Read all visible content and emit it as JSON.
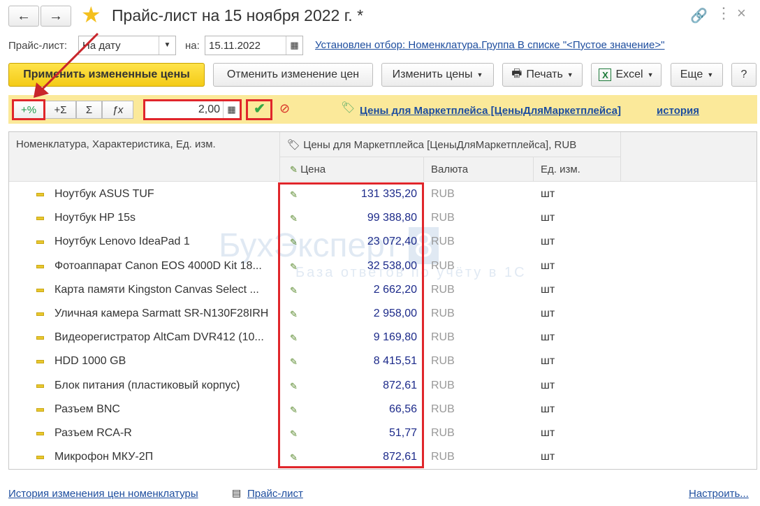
{
  "window": {
    "title": "Прайс-лист на 15 ноября 2022 г. *"
  },
  "filter": {
    "pricelist_label": "Прайс-лист:",
    "pricelist_value": "На дату",
    "date_label": "на:",
    "date_value": "15.11.2022",
    "filter_link": "Установлен отбор: Номенклатура.Группа В списке \"<Пустое значение>\""
  },
  "toolbar": {
    "apply": "Применить измененные цены",
    "cancel": "Отменить изменение цен",
    "change": "Изменить цены",
    "print": "Печать",
    "excel": "Excel",
    "more": "Еще",
    "help": "?"
  },
  "edit_panel": {
    "plus_percent": "+%",
    "plus_sum": "+Σ",
    "sum": "Σ",
    "fx": "ƒx",
    "value": "2,00",
    "price_type_link": "Цены для Маркетплейса [ЦеныДляМаркетплейса]",
    "history_link": "история"
  },
  "table": {
    "col_name": "Номенклатура, Характеристика, Ед. изм.",
    "col_group": "Цены для Маркетплейса [ЦеныДляМаркетплейса], RUB",
    "col_price": "Цена",
    "col_currency": "Валюта",
    "col_unit": "Ед. изм.",
    "rows": [
      {
        "name": "Ноутбук ASUS TUF",
        "price": "131 335,20",
        "currency": "RUB",
        "unit": "шт"
      },
      {
        "name": "Ноутбук HP 15s",
        "price": "99 388,80",
        "currency": "RUB",
        "unit": "шт"
      },
      {
        "name": "Ноутбук Lenovo IdeaPad 1",
        "price": "23 072,40",
        "currency": "RUB",
        "unit": "шт"
      },
      {
        "name": "Фотоаппарат Canon EOS 4000D Kit 18...",
        "price": "32 538,00",
        "currency": "RUB",
        "unit": "шт"
      },
      {
        "name": "Карта памяти Kingston Canvas Select ...",
        "price": "2 662,20",
        "currency": "RUB",
        "unit": "шт"
      },
      {
        "name": "Уличная камера Sarmatt SR-N130F28IRH",
        "price": "2 958,00",
        "currency": "RUB",
        "unit": "шт"
      },
      {
        "name": "Видеорегистратор AltCam DVR412 (10...",
        "price": "9 169,80",
        "currency": "RUB",
        "unit": "шт"
      },
      {
        "name": "HDD 1000 GB",
        "price": "8 415,51",
        "currency": "RUB",
        "unit": "шт"
      },
      {
        "name": "Блок питания (пластиковый корпус)",
        "price": "872,61",
        "currency": "RUB",
        "unit": "шт"
      },
      {
        "name": "Разъем BNC",
        "price": "66,56",
        "currency": "RUB",
        "unit": "шт"
      },
      {
        "name": "Разъем RCA-R",
        "price": "51,77",
        "currency": "RUB",
        "unit": "шт"
      },
      {
        "name": "Микрофон МКУ-2П",
        "price": "872,61",
        "currency": "RUB",
        "unit": "шт"
      }
    ]
  },
  "watermark": {
    "brand": "БухЭксперт",
    "num": "8",
    "tagline": "База ответов по учёту в 1С"
  },
  "footer": {
    "history": "История изменения цен номенклатуры",
    "pricelist": "Прайс-лист",
    "settings": "Настроить..."
  }
}
